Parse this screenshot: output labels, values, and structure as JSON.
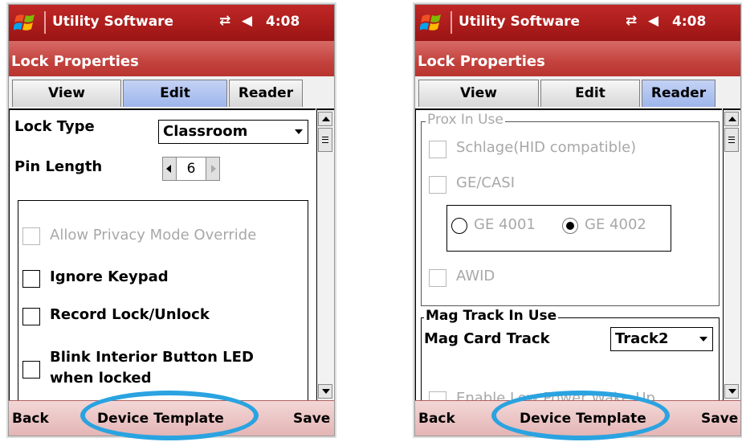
{
  "status_bar": {
    "app_name": "Utility Software",
    "time": "4:08",
    "icons": [
      "windows-logo-icon",
      "connectivity-icon",
      "speaker-icon"
    ]
  },
  "window_title": "Lock Properties",
  "tabs": [
    {
      "label": "View"
    },
    {
      "label": "Edit"
    },
    {
      "label": "Reader"
    }
  ],
  "left_screen": {
    "active_tab": "Edit",
    "lock_type": {
      "label": "Lock Type",
      "value": "Classroom"
    },
    "pin_length": {
      "label": "Pin Length",
      "value": "6"
    },
    "options": [
      {
        "label": "Allow Privacy Mode Override",
        "checked": false,
        "enabled": false
      },
      {
        "label": "Ignore Keypad",
        "checked": false,
        "enabled": true
      },
      {
        "label": "Record Lock/Unlock",
        "checked": false,
        "enabled": true
      },
      {
        "label_line1": "Blink Interior Button LED",
        "label_line2": "when locked",
        "checked": false,
        "enabled": true
      }
    ]
  },
  "right_screen": {
    "active_tab": "Reader",
    "prox_group": {
      "title": "Prox In Use",
      "schlage": "Schlage(HID compatible)",
      "ge_casi": "GE/CASI",
      "ge4001": "GE 4001",
      "ge4002": "GE 4002",
      "selected": "GE 4002",
      "awid": "AWID"
    },
    "mag_group": {
      "title": "Mag Track In Use",
      "mag_card_track_label": "Mag Card Track",
      "mag_card_track_value": "Track2",
      "low_power_label": "Enable Low Power Wake-Up"
    }
  },
  "softkeys": {
    "back": "Back",
    "template": "Device Template",
    "save": "Save"
  },
  "colors": {
    "title_red": "#c3423d",
    "active_tab_blue": "#9eb6ec",
    "highlight_ellipse": "#2aa3e0"
  }
}
